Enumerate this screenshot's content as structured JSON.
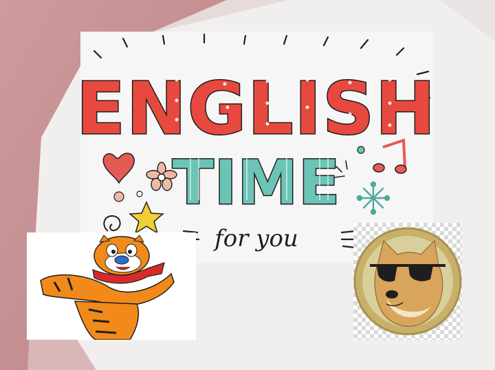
{
  "poster": {
    "title_line1": "ENGLISH",
    "title_line2": "TIME",
    "subtitle": "for you"
  },
  "colors": {
    "title_red": "#e8493f",
    "title_teal": "#6cc4b7",
    "outline": "#1e1e1e",
    "star_yellow": "#f2cf35",
    "heart_red": "#e45b55",
    "flower_pink": "#efb9a6",
    "sparkle_teal": "#4fa89d",
    "tiger_orange": "#f28a1a",
    "doge_tan": "#d9a55c",
    "coin_gold": "#c8b06a"
  },
  "icons": [
    "heart-icon",
    "flower-icon",
    "star-icon",
    "music-note-icon",
    "sparkle-icon",
    "swirl-icon"
  ]
}
